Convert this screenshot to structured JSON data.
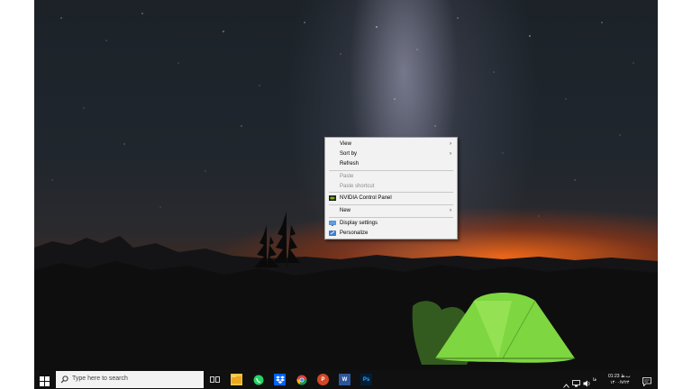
{
  "context_menu": {
    "view": "View",
    "sort_by": "Sort by",
    "refresh": "Refresh",
    "paste": "Paste",
    "paste_shortcut": "Paste shortcut",
    "nvidia": "NVIDIA Control Panel",
    "new": "New",
    "display_settings": "Display settings",
    "personalize": "Personalize",
    "submenu_arrow": "›"
  },
  "taskbar": {
    "search_placeholder": "Type here to search",
    "apps": [
      {
        "icon": "task-view-icon"
      },
      {
        "icon": "file-explorer-icon"
      },
      {
        "icon": "whatsapp-icon"
      },
      {
        "icon": "dropbox-icon"
      },
      {
        "icon": "chrome-icon"
      },
      {
        "icon": "powerpoint-icon",
        "label": "P"
      },
      {
        "icon": "word-icon",
        "label": "W"
      },
      {
        "icon": "photoshop-icon",
        "label": "Ps"
      }
    ],
    "tray": {
      "time": "01:23 ب.ظ",
      "date": "۱۴۰۰/۷/۲۴",
      "language": "فا"
    }
  },
  "colors": {
    "taskbar": "#101010",
    "menu_bg": "#f2f2f2",
    "tent": "#7ed640",
    "horizon": "#ff6e19"
  }
}
